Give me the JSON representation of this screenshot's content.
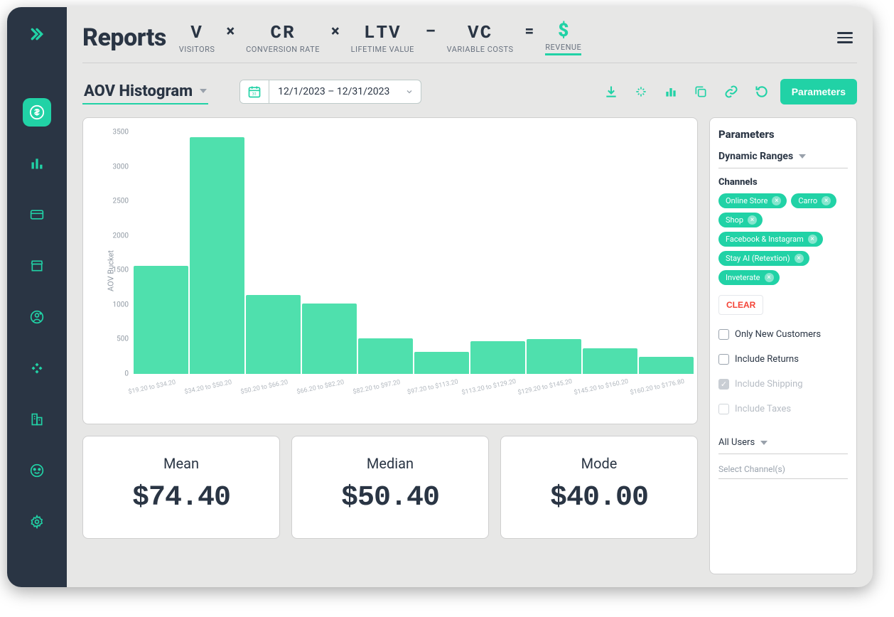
{
  "sidebar": {
    "items": [
      {
        "name": "revenue-nav",
        "active": true
      },
      {
        "name": "charts-nav"
      },
      {
        "name": "card-nav"
      },
      {
        "name": "store-nav"
      },
      {
        "name": "user-nav"
      },
      {
        "name": "gamepad-nav"
      },
      {
        "name": "building-nav"
      },
      {
        "name": "dashboard-nav"
      },
      {
        "name": "settings-nav"
      }
    ]
  },
  "header": {
    "title": "Reports",
    "formula": [
      {
        "sym": "V",
        "sub": "VISITORS"
      },
      {
        "sym": "CR",
        "sub": "CONVERSION RATE"
      },
      {
        "sym": "LTV",
        "sub": "LIFETIME VALUE"
      },
      {
        "sym": "VC",
        "sub": "VARIABLE COSTS"
      }
    ],
    "revenue_label": "REVENUE"
  },
  "toolbar": {
    "report_name": "AOV Histogram",
    "date_range": "12/1/2023 – 12/31/2023",
    "parameters_btn": "Parameters"
  },
  "params": {
    "title": "Parameters",
    "dynamic_ranges": "Dynamic Ranges",
    "channels_label": "Channels",
    "channels": [
      "Online Store",
      "Carro",
      "Shop",
      "Facebook & Instagram",
      "Stay AI (Retextion)",
      "Inveterate"
    ],
    "clear": "CLEAR",
    "checks": [
      {
        "label": "Only New Customers",
        "checked": false,
        "disabled": false
      },
      {
        "label": "Include Returns",
        "checked": false,
        "disabled": false
      },
      {
        "label": "Include Shipping",
        "checked": true,
        "disabled": true
      },
      {
        "label": "Include Taxes",
        "checked": false,
        "disabled": true
      }
    ],
    "all_users": "All Users",
    "select_channels": "Select Channel(s)"
  },
  "stats": [
    {
      "label": "Mean",
      "value": "$74.40"
    },
    {
      "label": "Median",
      "value": "$50.40"
    },
    {
      "label": "Mode",
      "value": "$40.00"
    }
  ],
  "chart_data": {
    "type": "bar",
    "title": "",
    "xlabel": "",
    "ylabel": "AOV Bucket",
    "ylim": [
      0,
      3500
    ],
    "y_ticks": [
      0,
      500,
      1000,
      1500,
      2000,
      2500,
      3000,
      3500
    ],
    "categories": [
      "$19.20 to $34.20",
      "$34.20 to $50.20",
      "$50.20 to $66.20",
      "$66.20 to $82.20",
      "$82.20 to $97.20",
      "$97.20 to $113.20",
      "$113.20 to $129.20",
      "$129.20 to $145.20",
      "$145.20 to $160.20",
      "$160.20 to $176.80"
    ],
    "values": [
      1570,
      3430,
      1140,
      1020,
      520,
      320,
      470,
      500,
      370,
      250
    ]
  }
}
